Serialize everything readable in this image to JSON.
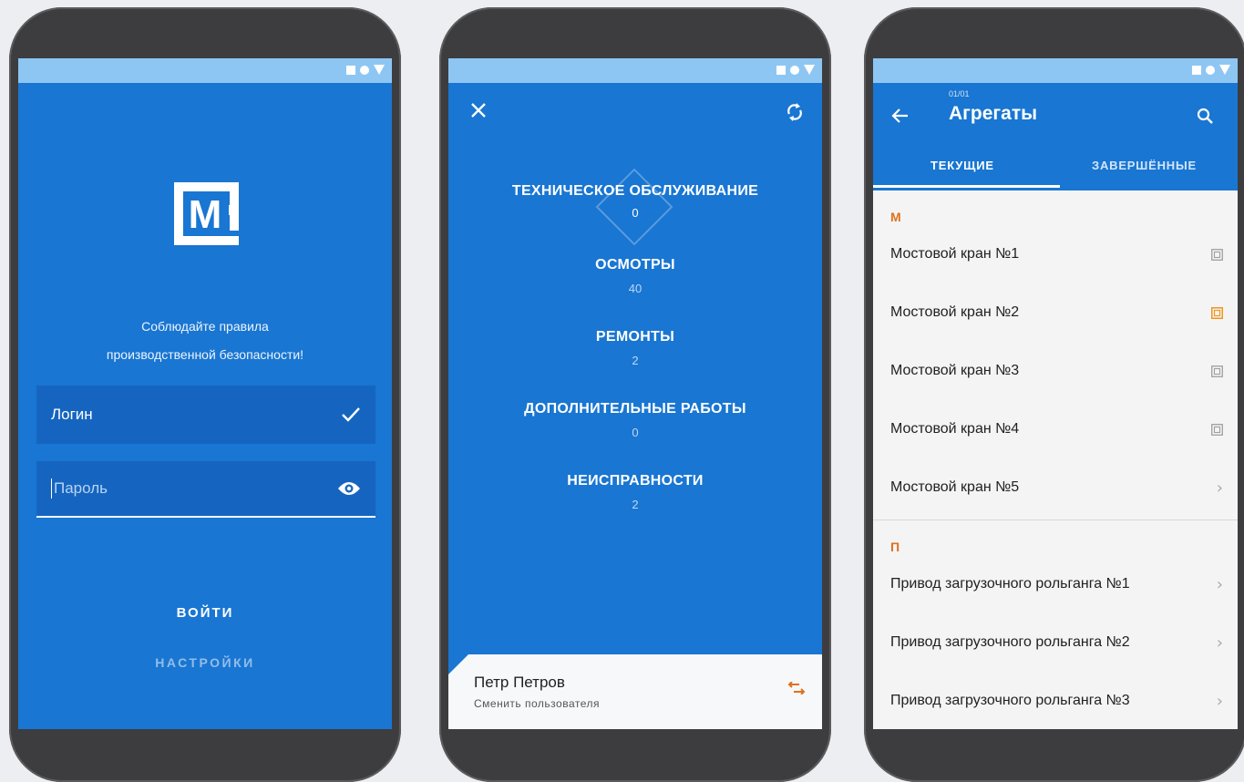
{
  "colors": {
    "primary": "#1976d2",
    "accent": "#e0711c",
    "statusbar": "#8ec6f3"
  },
  "login": {
    "logo_letter": "M",
    "safety_line1": "Соблюдайте правила",
    "safety_line2": "производственной безопасности!",
    "login_value": "Логин",
    "password_placeholder": "Пароль",
    "login_button": "ВОЙТИ",
    "settings_button": "НАСТРОЙКИ",
    "icons": {
      "login_status": "check-icon",
      "password_toggle": "eye-icon"
    }
  },
  "menu": {
    "icons": {
      "close": "close-icon",
      "sync": "sync-icon",
      "switch_user": "swap-icon"
    },
    "stats": [
      {
        "label": "ТЕХНИЧЕСКОЕ ОБСЛУЖИВАНИЕ",
        "value": "0"
      },
      {
        "label": "ОСМОТРЫ",
        "value": "40"
      },
      {
        "label": "РЕМОНТЫ",
        "value": "2"
      },
      {
        "label": "ДОПОЛНИТЕЛЬНЫЕ РАБОТЫ",
        "value": "0"
      },
      {
        "label": "НЕИСПРАВНОСТИ",
        "value": "2"
      }
    ],
    "user_name": "Петр Петров",
    "switch_user_label": "Сменить пользователя"
  },
  "units": {
    "counter": "01/01",
    "title": "Агрегаты",
    "tabs": [
      "ТЕКУЩИЕ",
      "ЗАВЕРШЁННЫЕ"
    ],
    "active_tab": "ТЕКУЩИЕ",
    "sections": [
      {
        "letter": "М",
        "items": [
          "Мостовой кран №1",
          "Мостовой кран №2",
          "Мостовой кран №3",
          "Мостовой кран №4",
          "Мостовой кран №5"
        ]
      },
      {
        "letter": "П",
        "items": [
          "Привод загрузочного рольганга №1",
          "Привод загрузочного рольганга №2",
          "Привод загрузочного рольганга №3"
        ]
      }
    ]
  }
}
